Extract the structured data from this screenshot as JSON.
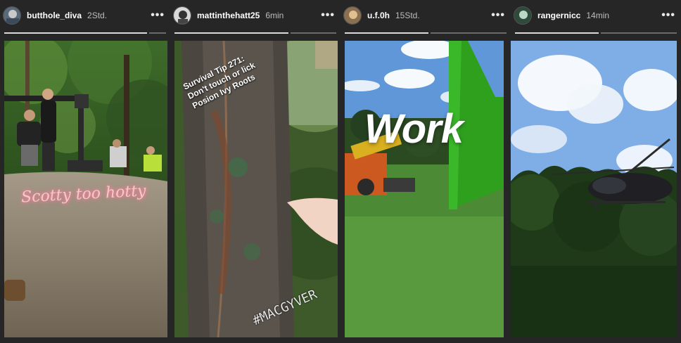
{
  "stories": [
    {
      "username": "butthole_diva",
      "time": "2Std.",
      "more_label": "•••",
      "progress": [
        1,
        0
      ],
      "overlay": "Scotty too hotty"
    },
    {
      "username": "mattinthehatt25",
      "time": "6min",
      "more_label": "•••",
      "progress": [
        1,
        0
      ],
      "overlay_lines": [
        "Survival Tip 271:",
        "Don't touch or lick",
        "Posion Ivy Roots"
      ],
      "hashtag": "#MACGYVER"
    },
    {
      "username": "u.f.0h",
      "time": "15Std.",
      "more_label": "•••",
      "progress": [
        1,
        0
      ],
      "overlay": "Work"
    },
    {
      "username": "rangernicc",
      "time": "14min",
      "more_label": "•••",
      "progress": [
        1,
        0
      ]
    }
  ],
  "colors": {
    "background": "#262626",
    "progress_done": "#d9d9d9",
    "progress_pending": "#6b6b6b"
  }
}
